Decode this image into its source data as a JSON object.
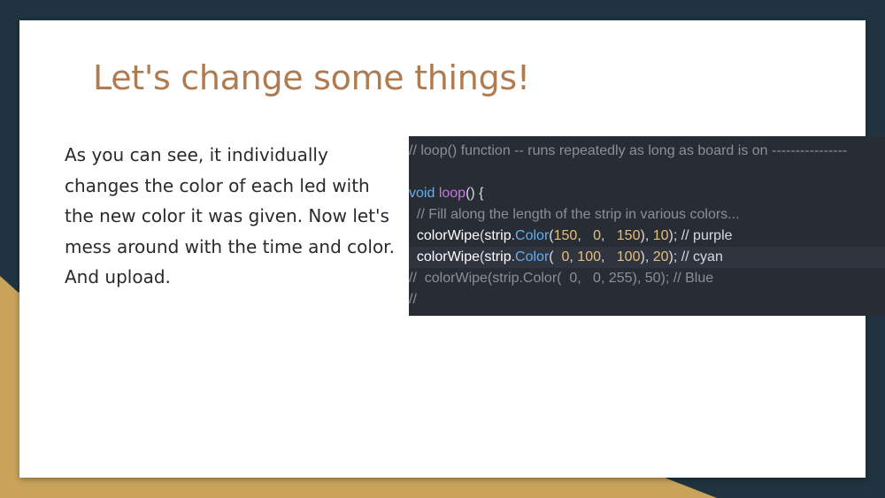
{
  "slide": {
    "title": "Let's change some things!",
    "body": "As you can see, it individually changes the color of each led with the new color it was given. Now let's mess around with the time and color. And upload."
  },
  "code": {
    "line1": "// loop() function -- runs repeatedly as long as board is on ----------------",
    "line2": "",
    "line3": {
      "kw": "void",
      "sp": " ",
      "fn": "loop",
      "rest": "() {"
    },
    "line4": "  // Fill along the length of the strip in various colors...",
    "line5": {
      "indent": "  ",
      "call": "colorWipe",
      "p1": "(",
      "obj": "strip",
      "dot": ".",
      "method": "Color",
      "p2": "(",
      "a": "150",
      "s1": ",   ",
      "b": "0",
      "s2": ",   ",
      "c": "150",
      "p3": "), ",
      "d": "10",
      "end": "); // purple"
    },
    "line6": {
      "indent": "  ",
      "call": "colorWipe",
      "p1": "(",
      "obj": "strip",
      "dot": ".",
      "method": "Color",
      "p2": "(  ",
      "a": "0",
      "s1": ", ",
      "b": "100",
      "s2": ",   ",
      "c": "100",
      "p3": "), ",
      "d": "20",
      "end": "); // cyan"
    },
    "line7": "//  colorWipe(strip.Color(  0,   0, 255), 50); // Blue",
    "line8": "//"
  },
  "colors": {
    "background": "#1f3440",
    "gold": "#c9a35a",
    "title": "#b07b4f",
    "code_bg": "#282c34"
  }
}
